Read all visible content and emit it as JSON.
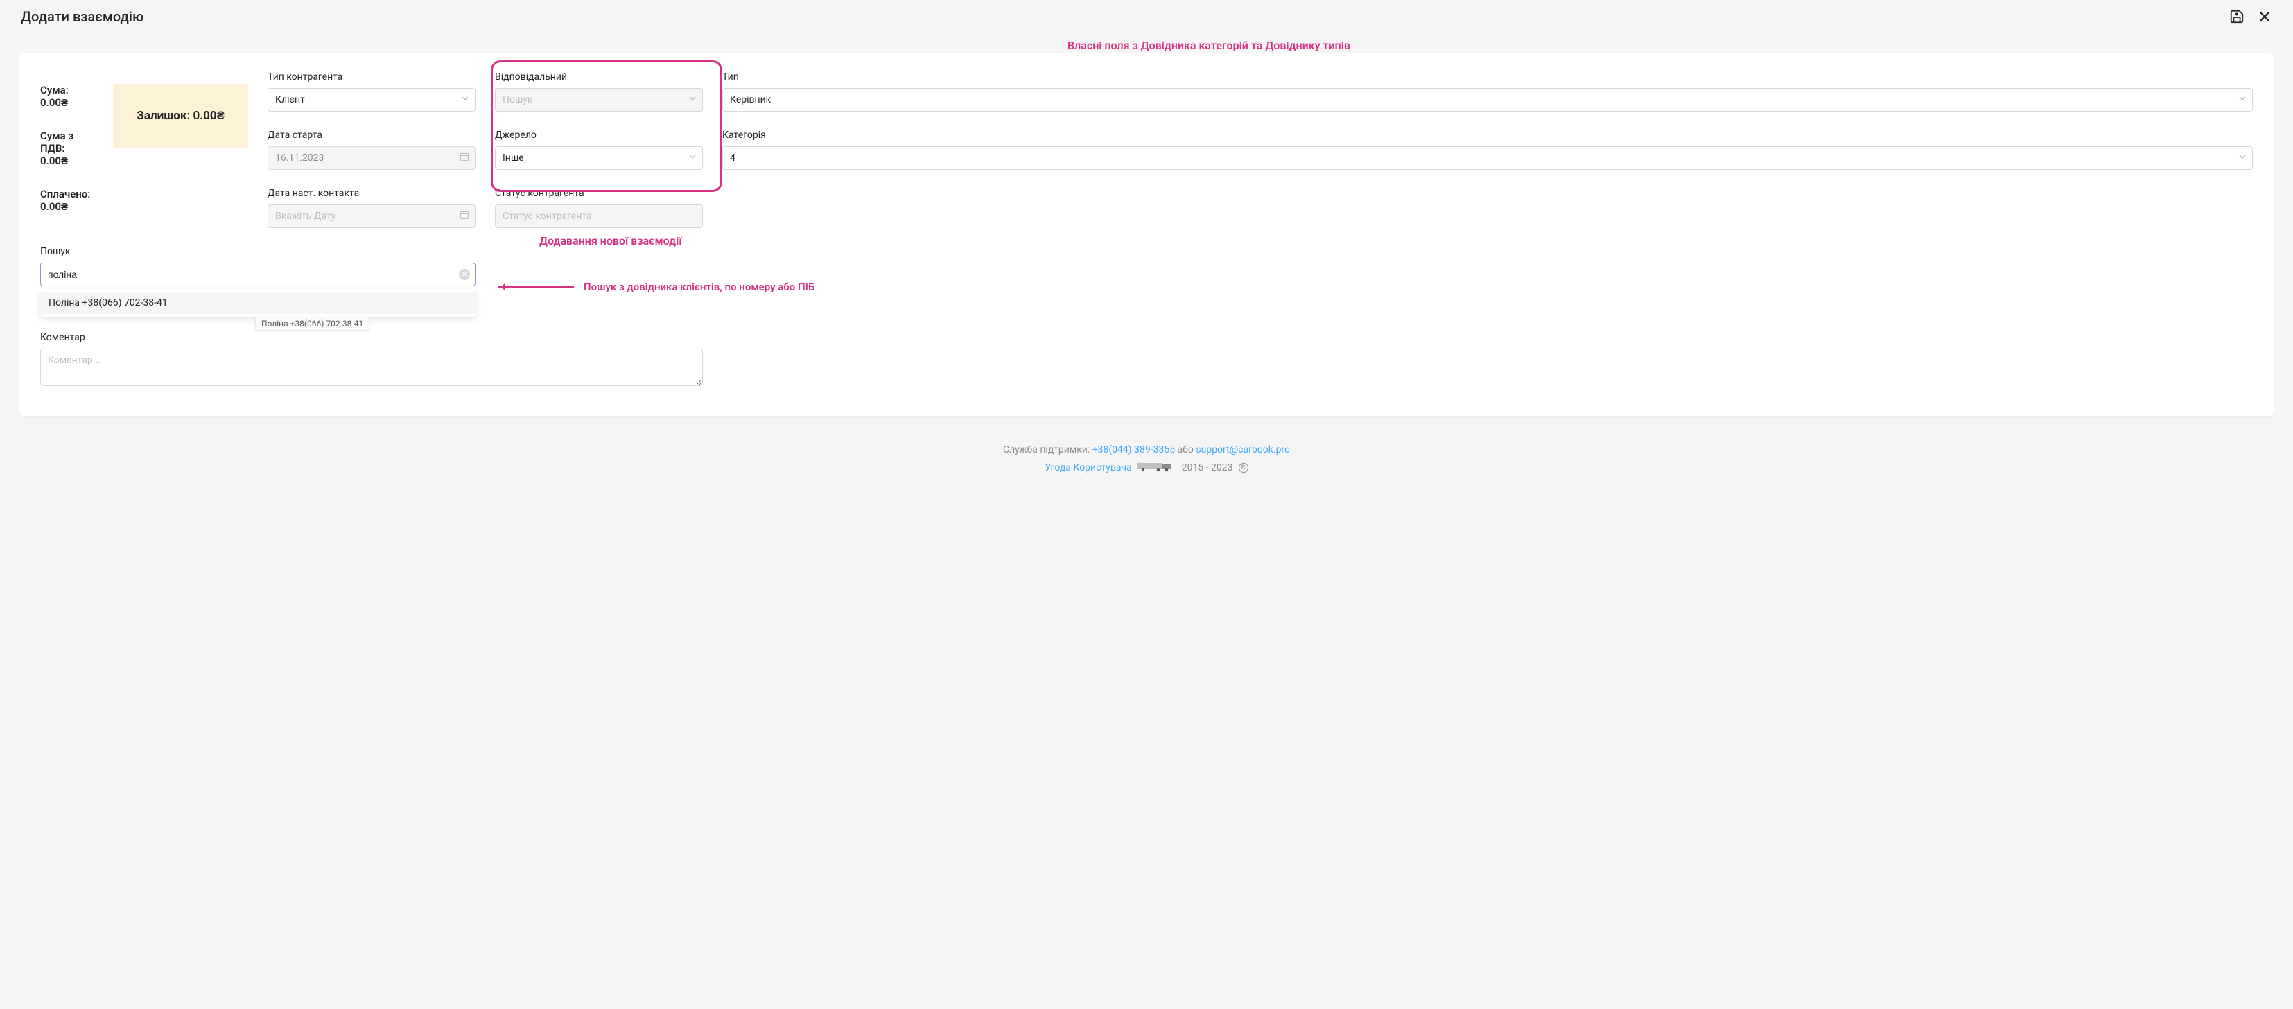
{
  "header": {
    "title": "Додати взаємодію"
  },
  "annotations": {
    "top": "Власні поля  з Довідника категорій та Довіднику типів",
    "middle": "Додавання нової взаємодії",
    "search": "Пошук з довідника клієнтів, по номеру або ПІБ"
  },
  "fields": {
    "counterparty_type": {
      "label": "Тип контрагента",
      "value": "Клієнт"
    },
    "responsible": {
      "label": "Відповідальний",
      "placeholder": "Пошук"
    },
    "type": {
      "label": "Тип",
      "value": "Керівник"
    },
    "start_date": {
      "label": "Дата старта",
      "value": "16.11.2023"
    },
    "source": {
      "label": "Джерело",
      "value": "Інше"
    },
    "category": {
      "label": "Категорія",
      "value": "4"
    },
    "next_contact_date": {
      "label": "Дата наст. контакта",
      "placeholder": "Вкажіть Дату"
    },
    "counterparty_status": {
      "label": "Статус контрагента",
      "placeholder": "Статус контрагента"
    },
    "search": {
      "label": "Пошук",
      "value": "поліна"
    },
    "comment": {
      "label": "Коментар",
      "placeholder": "Коментар..."
    }
  },
  "search_dropdown": {
    "option": "Поліна +38(066) 702-38-41",
    "tooltip": "Поліна  +38(066) 702-38-41"
  },
  "summary": {
    "sum_label": "Сума: 0.00₴",
    "sum_vat_label": "Сума з ПДВ: 0.00₴",
    "paid_label": "Сплачено: 0.00₴",
    "balance_label": "Залишок: 0.00₴"
  },
  "footer": {
    "support_prefix": "Служба підтримки: ",
    "phone": "+38(044) 389-3355",
    "or": " або ",
    "email": "support@carbook.pro",
    "agreement": "Угода Користувача",
    "years": "2015 - 2023"
  }
}
